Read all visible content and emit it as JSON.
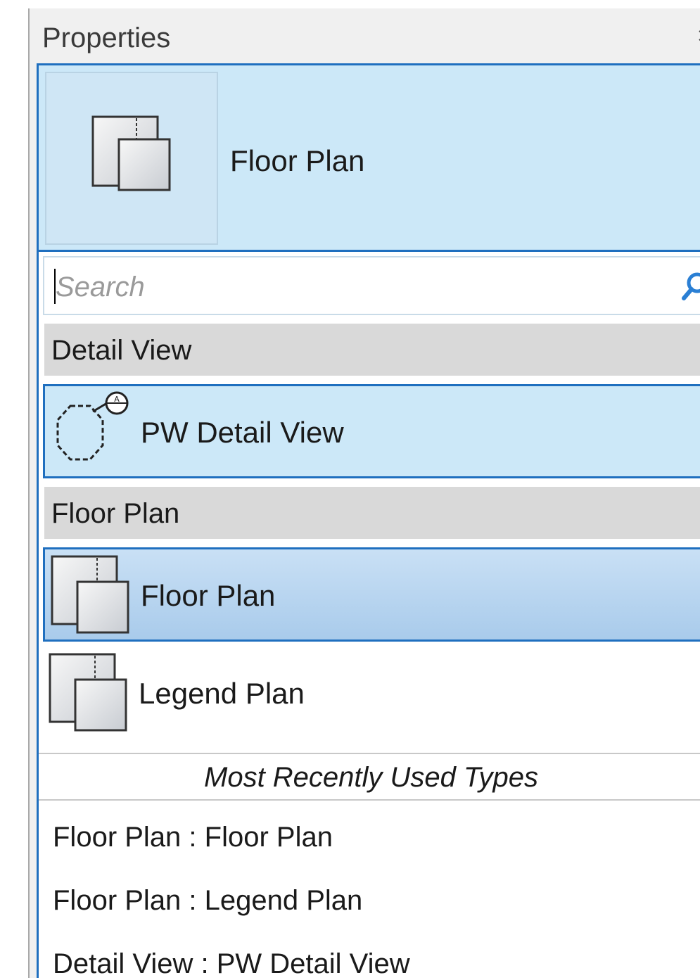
{
  "panel": {
    "title": "Properties",
    "close_glyph": "×"
  },
  "type_selector": {
    "current_type": "Floor Plan",
    "preview_icon": "floor-plan-icon"
  },
  "search": {
    "placeholder": "Search",
    "value": "",
    "icon": "search-icon"
  },
  "groups": [
    {
      "name": "Detail View",
      "items": [
        {
          "label": "PW Detail View",
          "icon": "detail-view-icon",
          "state": "hover"
        }
      ]
    },
    {
      "name": "Floor Plan",
      "items": [
        {
          "label": "Floor Plan",
          "icon": "floor-plan-icon",
          "state": "selected"
        },
        {
          "label": "Legend Plan",
          "icon": "floor-plan-icon",
          "state": "normal"
        }
      ]
    }
  ],
  "most_recently_used": {
    "title": "Most Recently Used Types",
    "items": [
      "Floor Plan : Floor Plan",
      "Floor Plan : Legend Plan",
      "Detail View : PW Detail View"
    ]
  },
  "colors": {
    "accent_border": "#1f6fbf",
    "selection_fill": "#cce8f8",
    "group_header": "#d9d9d9"
  }
}
